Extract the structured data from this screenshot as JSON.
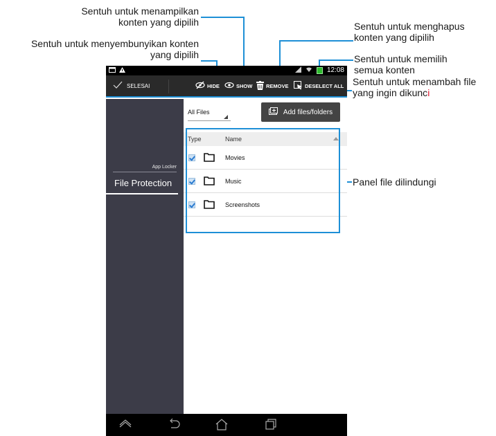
{
  "callouts": {
    "show": [
      "Sentuh untuk menampilkan",
      "konten yang dipilih"
    ],
    "hide": [
      "Sentuh untuk menyembunyikan konten",
      "yang dipilih"
    ],
    "remove": [
      "Sentuh untuk menghapus",
      "konten yang dipilih"
    ],
    "deselect": [
      "Sentuh untuk memilih",
      "semua konten"
    ],
    "add": [
      "Sentuh untuk menambah file",
      "yang ingin dikunc",
      "i"
    ],
    "panel": "Panel file dilindungi"
  },
  "status_bar": {
    "time": "12:08"
  },
  "action_bar": {
    "done_label": "SELESAI",
    "hide_label": "HIDE",
    "show_label": "SHOW",
    "remove_label": "REMOVE",
    "deselect_label": "DESELECT ALL"
  },
  "sidebar": {
    "caption": "App Locker",
    "item": "File Protection"
  },
  "content": {
    "filter_value": "All Files",
    "add_button_label": "Add files/folders",
    "columns": [
      "Type",
      "Name"
    ],
    "rows": [
      {
        "name": "Movies",
        "checked": true
      },
      {
        "name": "Music",
        "checked": true
      },
      {
        "name": "Screenshots",
        "checked": true
      }
    ]
  },
  "colors": {
    "callout_line": "#1d8fd6",
    "sidebar_bg": "#3c3c48",
    "action_bar_bg": "#2a2a2a"
  }
}
